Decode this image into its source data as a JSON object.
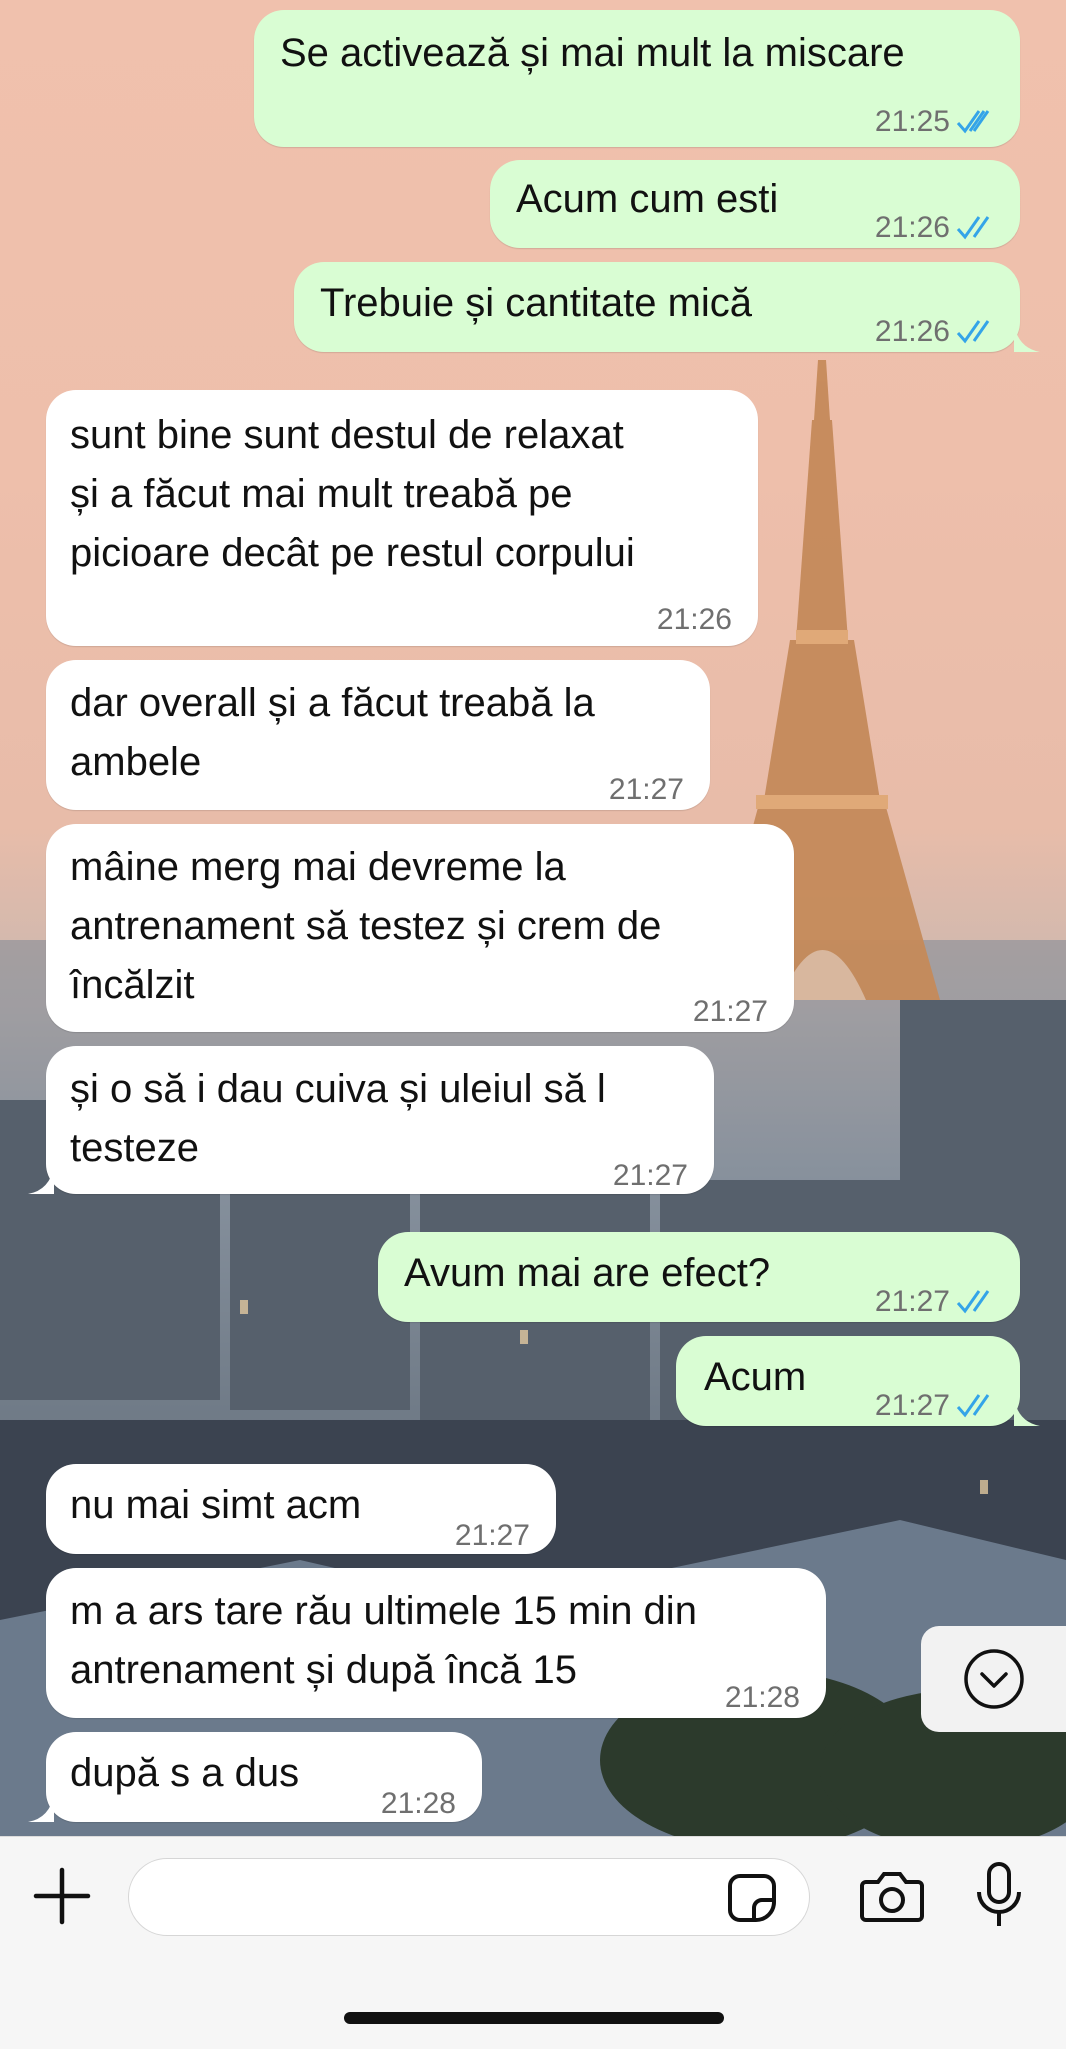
{
  "messages": [
    {
      "dir": "out",
      "text": "Se activează și mai mult la miscare",
      "time": "21:25"
    },
    {
      "dir": "out",
      "text": "Acum cum esti",
      "time": "21:26"
    },
    {
      "dir": "out",
      "text": "Trebuie și cantitate mică",
      "time": "21:26"
    },
    {
      "dir": "in",
      "lines": [
        "sunt bine sunt destul de relaxat",
        "și a făcut mai mult treabă pe",
        "picioare decât pe restul corpului"
      ],
      "time": "21:26"
    },
    {
      "dir": "in",
      "lines": [
        "dar overall și a făcut treabă la",
        "ambele"
      ],
      "time": "21:27"
    },
    {
      "dir": "in",
      "lines": [
        "mâine merg mai devreme la",
        "antrenament să testez și crem de",
        "încălzit"
      ],
      "time": "21:27"
    },
    {
      "dir": "in",
      "lines": [
        "și o să i dau cuiva și uleiul să l",
        "testeze"
      ],
      "time": "21:27"
    },
    {
      "dir": "out",
      "text": "Avum mai are efect?",
      "time": "21:27"
    },
    {
      "dir": "out",
      "text": "Acum",
      "time": "21:27"
    },
    {
      "dir": "in",
      "lines": [
        "nu mai simt acm"
      ],
      "time": "21:27"
    },
    {
      "dir": "in",
      "lines": [
        "m a ars tare rău ultimele 15 min din",
        "antrenament și după încă 15"
      ],
      "time": "21:28"
    },
    {
      "dir": "in",
      "lines": [
        "după s a dus"
      ],
      "time": "21:28"
    }
  ],
  "composer": {
    "input_value": "",
    "icons": [
      "plus-icon",
      "sticker-icon",
      "camera-icon",
      "microphone-icon"
    ]
  },
  "scroll_button_icon": "chevron-down-icon",
  "colors": {
    "outgoing_bubble": "#d9fdd3",
    "incoming_bubble": "#ffffff",
    "read_ticks": "#34a4e8"
  }
}
